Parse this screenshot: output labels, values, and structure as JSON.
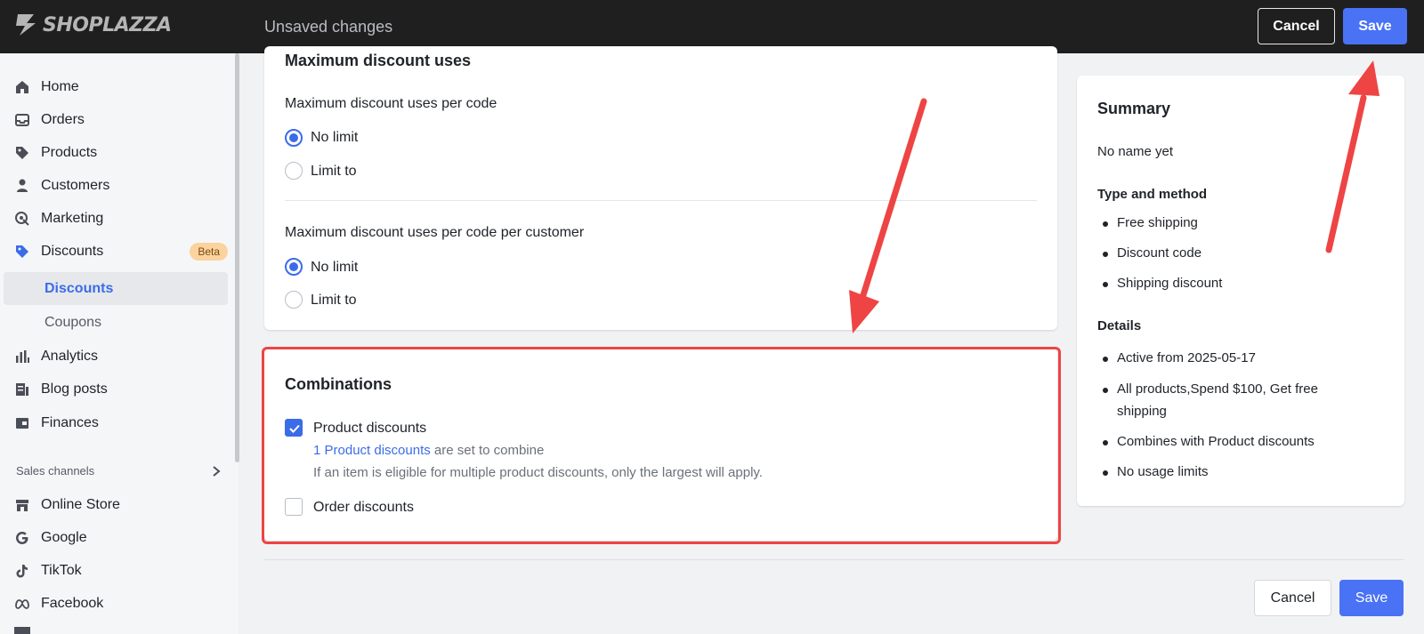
{
  "header": {
    "brand": "SHOPLAZZA",
    "status": "Unsaved changes",
    "cancel_label": "Cancel",
    "save_label": "Save"
  },
  "sidebar": {
    "items": [
      {
        "label": "Home",
        "icon": "home-icon"
      },
      {
        "label": "Orders",
        "icon": "orders-icon"
      },
      {
        "label": "Products",
        "icon": "tag-icon"
      },
      {
        "label": "Customers",
        "icon": "person-icon"
      },
      {
        "label": "Marketing",
        "icon": "marketing-icon"
      },
      {
        "label": "Discounts",
        "icon": "discount-tag-icon",
        "badge": "Beta"
      },
      {
        "label": "Analytics",
        "icon": "bar-chart-icon"
      },
      {
        "label": "Blog posts",
        "icon": "blog-icon"
      },
      {
        "label": "Finances",
        "icon": "finance-icon"
      }
    ],
    "sub_items": [
      {
        "label": "Discounts",
        "active": true
      },
      {
        "label": "Coupons",
        "active": false
      }
    ],
    "section_title": "Sales channels",
    "channels": [
      {
        "label": "Online Store",
        "icon": "store-icon"
      },
      {
        "label": "Google",
        "icon": "google-icon"
      },
      {
        "label": "TikTok",
        "icon": "tiktok-icon"
      },
      {
        "label": "Facebook",
        "icon": "meta-icon"
      }
    ]
  },
  "max_uses": {
    "title": "Maximum discount uses",
    "per_code": {
      "label": "Maximum discount uses per code",
      "options": [
        "No limit",
        "Limit to"
      ],
      "selected": "No limit"
    },
    "per_customer": {
      "label": "Maximum discount uses per code per customer",
      "options": [
        "No limit",
        "Limit to"
      ],
      "selected": "No limit"
    }
  },
  "combinations": {
    "title": "Combinations",
    "product": {
      "label": "Product discounts",
      "checked": true,
      "link_text": "1 Product discounts",
      "link_suffix": "are set to combine",
      "help": "If an item is eligible for multiple product discounts, only the largest will apply."
    },
    "order": {
      "label": "Order discounts",
      "checked": false
    }
  },
  "summary": {
    "title": "Summary",
    "name": "No name yet",
    "type_title": "Type and method",
    "type_items": [
      "Free shipping",
      "Discount code",
      "Shipping discount"
    ],
    "details_title": "Details",
    "details_items": [
      "Active from 2025-05-17",
      "All products,Spend $100, Get free",
      "shipping",
      "Combines with Product discounts",
      "No usage limits"
    ]
  },
  "footer": {
    "cancel_label": "Cancel",
    "save_label": "Save"
  },
  "colors": {
    "accent": "#3b6ce8",
    "save_button": "#4a72f5",
    "highlight": "#ee4444",
    "topbar": "#1f1f1f"
  }
}
